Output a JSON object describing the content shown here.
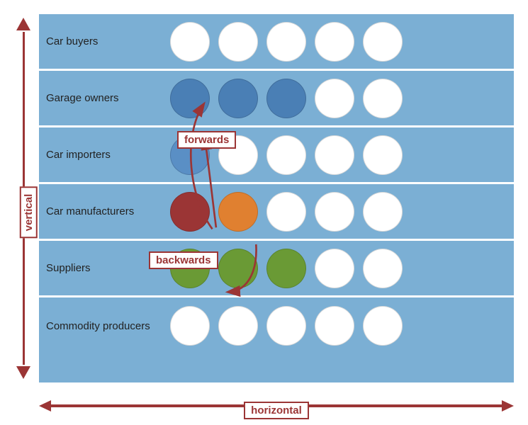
{
  "rows": [
    {
      "id": "car-buyers",
      "label": "Car buyers",
      "circles": [
        {
          "type": "white"
        },
        {
          "type": "white"
        },
        {
          "type": "white"
        },
        {
          "type": "white"
        },
        {
          "type": "white"
        }
      ]
    },
    {
      "id": "garage-owners",
      "label": "Garage owners",
      "circles": [
        {
          "type": "blue"
        },
        {
          "type": "blue"
        },
        {
          "type": "blue"
        },
        {
          "type": "white"
        },
        {
          "type": "white"
        }
      ]
    },
    {
      "id": "car-importers",
      "label": "Car importers",
      "circles": [
        {
          "type": "blue2"
        },
        {
          "type": "white"
        },
        {
          "type": "white"
        },
        {
          "type": "white"
        },
        {
          "type": "white"
        }
      ]
    },
    {
      "id": "car-manufacturers",
      "label": "Car manufacturers",
      "circles": [
        {
          "type": "dark-red"
        },
        {
          "type": "orange"
        },
        {
          "type": "white"
        },
        {
          "type": "white"
        },
        {
          "type": "white"
        }
      ]
    },
    {
      "id": "suppliers",
      "label": "Suppliers",
      "circles": [
        {
          "type": "green"
        },
        {
          "type": "green"
        },
        {
          "type": "green"
        },
        {
          "type": "white"
        },
        {
          "type": "white"
        }
      ]
    },
    {
      "id": "commodity-producers",
      "label": "Commodity producers",
      "circles": [
        {
          "type": "white"
        },
        {
          "type": "white"
        },
        {
          "type": "white"
        },
        {
          "type": "white"
        },
        {
          "type": "white"
        }
      ]
    }
  ],
  "labels": {
    "vertical": "vertical",
    "horizontal": "horizontal",
    "forwards": "forwards",
    "backwards": "backwards"
  },
  "arrows": {
    "arrowColor": "#9b3535"
  }
}
